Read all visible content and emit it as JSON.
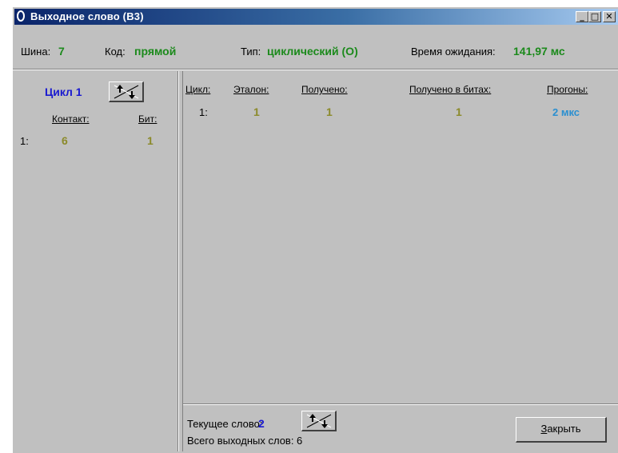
{
  "window": {
    "title": "Выходное слово (В3)",
    "controls": {
      "minimize": "_",
      "maximize": "□",
      "close": "✕"
    }
  },
  "info": {
    "bus_label": "Шина:",
    "bus_value": "7",
    "code_label": "Код:",
    "code_value": "прямой",
    "type_label": "Тип:",
    "type_value": "циклический (О)",
    "wait_label": "Время ожидания:",
    "wait_value": "141,97 мс"
  },
  "left": {
    "cycle_label": "Цикл 1",
    "headers": {
      "contact": "Контакт:",
      "bit": "Бит:"
    },
    "rows": [
      {
        "index": "1:",
        "contact": "6",
        "bit": "1"
      }
    ]
  },
  "right": {
    "headers": {
      "cycle": "Цикл:",
      "standard": "Эталон:",
      "received": "Получено:",
      "received_bits": "Получено в битах:",
      "runs": "Прогоны:"
    },
    "rows": [
      {
        "cycle": "1:",
        "standard": "1",
        "received": "1",
        "received_bits": "1",
        "runs": "2 мкс"
      }
    ],
    "current_word_label": "Текущее слово:",
    "current_word_value": "2",
    "total_words": "Всего выходных слов: 6",
    "close_button_mnemonic": "З",
    "close_button_rest": "акрыть"
  },
  "colors": {
    "title_gradient_start": "#0a246a",
    "value_green": "#1c8a1c",
    "value_olive": "#8b8a2a",
    "value_blue": "#1a1ad0",
    "value_cyan": "#2a8fd0",
    "face": "#c0c0c0"
  },
  "icons": [
    "window-app-icon",
    "minimize-icon",
    "maximize-icon",
    "close-icon",
    "sort-arrows-icon"
  ]
}
